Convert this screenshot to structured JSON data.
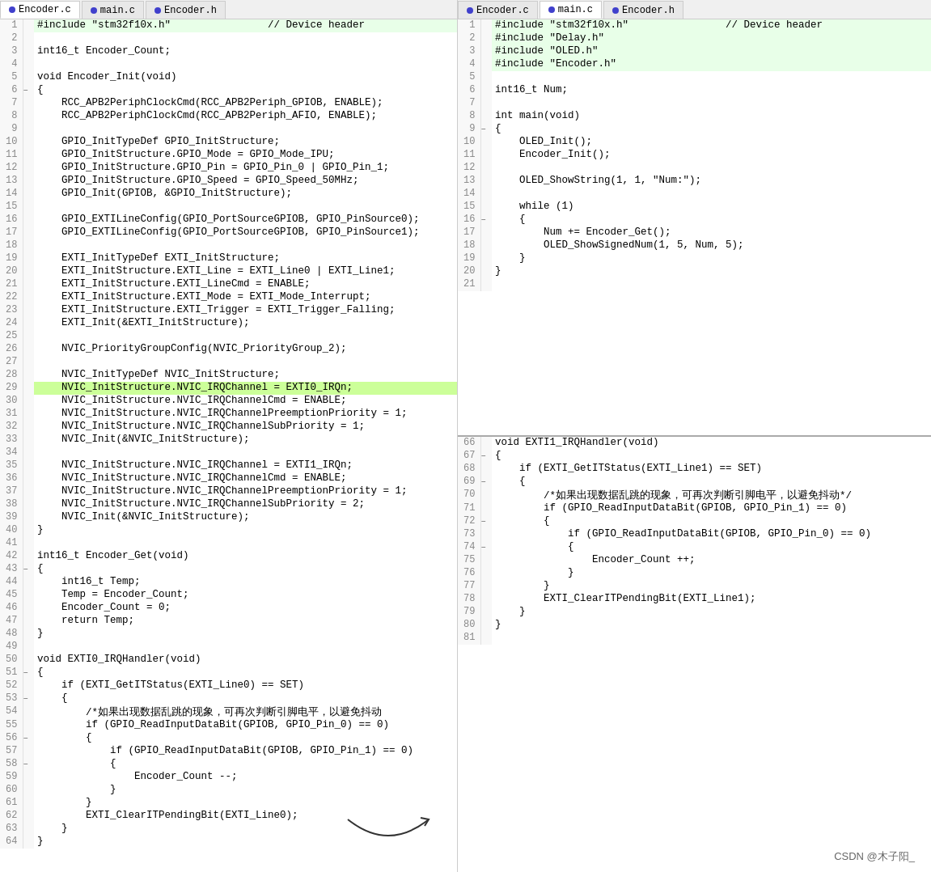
{
  "left_pane": {
    "tabs": [
      {
        "label": "Encoder.c",
        "active": true,
        "type": "encoder-c"
      },
      {
        "label": "main.c",
        "active": false,
        "type": "main-c"
      },
      {
        "label": "Encoder.h",
        "active": false,
        "type": "encoder-h"
      }
    ],
    "lines": [
      {
        "num": 1,
        "content": "#include \"stm32f10x.h\"                // Device header",
        "style": "include-green",
        "gutter": ""
      },
      {
        "num": 2,
        "content": "",
        "style": "",
        "gutter": ""
      },
      {
        "num": 3,
        "content": "int16_t Encoder_Count;",
        "style": "",
        "gutter": ""
      },
      {
        "num": 4,
        "content": "",
        "style": "",
        "gutter": ""
      },
      {
        "num": 5,
        "content": "void Encoder_Init(void)",
        "style": "",
        "gutter": ""
      },
      {
        "num": 6,
        "content": "{",
        "style": "",
        "gutter": "□"
      },
      {
        "num": 7,
        "content": "    RCC_APB2PeriphClockCmd(RCC_APB2Periph_GPIOB, ENABLE);",
        "style": "",
        "gutter": ""
      },
      {
        "num": 8,
        "content": "    RCC_APB2PeriphClockCmd(RCC_APB2Periph_AFIO, ENABLE);",
        "style": "",
        "gutter": ""
      },
      {
        "num": 9,
        "content": "",
        "style": "",
        "gutter": ""
      },
      {
        "num": 10,
        "content": "    GPIO_InitTypeDef GPIO_InitStructure;",
        "style": "",
        "gutter": ""
      },
      {
        "num": 11,
        "content": "    GPIO_InitStructure.GPIO_Mode = GPIO_Mode_IPU;",
        "style": "",
        "gutter": ""
      },
      {
        "num": 12,
        "content": "    GPIO_InitStructure.GPIO_Pin = GPIO_Pin_0 | GPIO_Pin_1;",
        "style": "",
        "gutter": ""
      },
      {
        "num": 13,
        "content": "    GPIO_InitStructure.GPIO_Speed = GPIO_Speed_50MHz;",
        "style": "",
        "gutter": ""
      },
      {
        "num": 14,
        "content": "    GPIO_Init(GPIOB, &GPIO_InitStructure);",
        "style": "",
        "gutter": ""
      },
      {
        "num": 15,
        "content": "",
        "style": "",
        "gutter": ""
      },
      {
        "num": 16,
        "content": "    GPIO_EXTILineConfig(GPIO_PortSourceGPIOB, GPIO_PinSource0);",
        "style": "",
        "gutter": ""
      },
      {
        "num": 17,
        "content": "    GPIO_EXTILineConfig(GPIO_PortSourceGPIOB, GPIO_PinSource1);",
        "style": "",
        "gutter": ""
      },
      {
        "num": 18,
        "content": "",
        "style": "",
        "gutter": ""
      },
      {
        "num": 19,
        "content": "    EXTI_InitTypeDef EXTI_InitStructure;",
        "style": "",
        "gutter": ""
      },
      {
        "num": 20,
        "content": "    EXTI_InitStructure.EXTI_Line = EXTI_Line0 | EXTI_Line1;",
        "style": "",
        "gutter": ""
      },
      {
        "num": 21,
        "content": "    EXTI_InitStructure.EXTI_LineCmd = ENABLE;",
        "style": "",
        "gutter": ""
      },
      {
        "num": 22,
        "content": "    EXTI_InitStructure.EXTI_Mode = EXTI_Mode_Interrupt;",
        "style": "",
        "gutter": ""
      },
      {
        "num": 23,
        "content": "    EXTI_InitStructure.EXTI_Trigger = EXTI_Trigger_Falling;",
        "style": "",
        "gutter": ""
      },
      {
        "num": 24,
        "content": "    EXTI_Init(&EXTI_InitStructure);",
        "style": "",
        "gutter": ""
      },
      {
        "num": 25,
        "content": "",
        "style": "",
        "gutter": ""
      },
      {
        "num": 26,
        "content": "    NVIC_PriorityGroupConfig(NVIC_PriorityGroup_2);",
        "style": "",
        "gutter": ""
      },
      {
        "num": 27,
        "content": "",
        "style": "",
        "gutter": ""
      },
      {
        "num": 28,
        "content": "    NVIC_InitTypeDef NVIC_InitStructure;",
        "style": "",
        "gutter": ""
      },
      {
        "num": 29,
        "content": "    NVIC_InitStructure.NVIC_IRQChannel = EXTI0_IRQn;",
        "style": "highlighted",
        "gutter": ""
      },
      {
        "num": 30,
        "content": "    NVIC_InitStructure.NVIC_IRQChannelCmd = ENABLE;",
        "style": "",
        "gutter": ""
      },
      {
        "num": 31,
        "content": "    NVIC_InitStructure.NVIC_IRQChannelPreemptionPriority = 1;",
        "style": "",
        "gutter": ""
      },
      {
        "num": 32,
        "content": "    NVIC_InitStructure.NVIC_IRQChannelSubPriority = 1;",
        "style": "",
        "gutter": ""
      },
      {
        "num": 33,
        "content": "    NVIC_Init(&NVIC_InitStructure);",
        "style": "",
        "gutter": ""
      },
      {
        "num": 34,
        "content": "",
        "style": "",
        "gutter": ""
      },
      {
        "num": 35,
        "content": "    NVIC_InitStructure.NVIC_IRQChannel = EXTI1_IRQn;",
        "style": "",
        "gutter": ""
      },
      {
        "num": 36,
        "content": "    NVIC_InitStructure.NVIC_IRQChannelCmd = ENABLE;",
        "style": "",
        "gutter": ""
      },
      {
        "num": 37,
        "content": "    NVIC_InitStructure.NVIC_IRQChannelPreemptionPriority = 1;",
        "style": "",
        "gutter": ""
      },
      {
        "num": 38,
        "content": "    NVIC_InitStructure.NVIC_IRQChannelSubPriority = 2;",
        "style": "",
        "gutter": ""
      },
      {
        "num": 39,
        "content": "    NVIC_Init(&NVIC_InitStructure);",
        "style": "",
        "gutter": ""
      },
      {
        "num": 40,
        "content": "}",
        "style": "",
        "gutter": ""
      },
      {
        "num": 41,
        "content": "",
        "style": "",
        "gutter": ""
      },
      {
        "num": 42,
        "content": "int16_t Encoder_Get(void)",
        "style": "",
        "gutter": ""
      },
      {
        "num": 43,
        "content": "{",
        "style": "",
        "gutter": "□"
      },
      {
        "num": 44,
        "content": "    int16_t Temp;",
        "style": "",
        "gutter": ""
      },
      {
        "num": 45,
        "content": "    Temp = Encoder_Count;",
        "style": "",
        "gutter": ""
      },
      {
        "num": 46,
        "content": "    Encoder_Count = 0;",
        "style": "",
        "gutter": ""
      },
      {
        "num": 47,
        "content": "    return Temp;",
        "style": "",
        "gutter": ""
      },
      {
        "num": 48,
        "content": "}",
        "style": "",
        "gutter": ""
      },
      {
        "num": 49,
        "content": "",
        "style": "",
        "gutter": ""
      },
      {
        "num": 50,
        "content": "void EXTI0_IRQHandler(void)",
        "style": "",
        "gutter": ""
      },
      {
        "num": 51,
        "content": "{",
        "style": "",
        "gutter": "□"
      },
      {
        "num": 52,
        "content": "    if (EXTI_GetITStatus(EXTI_Line0) == SET)",
        "style": "",
        "gutter": ""
      },
      {
        "num": 53,
        "content": "    {",
        "style": "",
        "gutter": "□"
      },
      {
        "num": 54,
        "content": "        /*如果出现数据乱跳的现象，可再次判断引脚电平，以避免抖动",
        "style": "",
        "gutter": ""
      },
      {
        "num": 55,
        "content": "        if (GPIO_ReadInputDataBit(GPIOB, GPIO_Pin_0) == 0)",
        "style": "",
        "gutter": ""
      },
      {
        "num": 56,
        "content": "        {",
        "style": "",
        "gutter": "□"
      },
      {
        "num": 57,
        "content": "            if (GPIO_ReadInputDataBit(GPIOB, GPIO_Pin_1) == 0)",
        "style": "",
        "gutter": ""
      },
      {
        "num": 58,
        "content": "            {",
        "style": "",
        "gutter": "□"
      },
      {
        "num": 59,
        "content": "                Encoder_Count --;",
        "style": "",
        "gutter": ""
      },
      {
        "num": 60,
        "content": "            }",
        "style": "",
        "gutter": ""
      },
      {
        "num": 61,
        "content": "        }",
        "style": "",
        "gutter": ""
      },
      {
        "num": 62,
        "content": "        EXTI_ClearITPendingBit(EXTI_Line0);",
        "style": "",
        "gutter": ""
      },
      {
        "num": 63,
        "content": "    }",
        "style": "",
        "gutter": ""
      },
      {
        "num": 64,
        "content": "}",
        "style": "",
        "gutter": ""
      }
    ]
  },
  "right_pane_top": {
    "tabs": [
      {
        "label": "Encoder.c",
        "active": false,
        "type": "encoder-c"
      },
      {
        "label": "main.c",
        "active": true,
        "type": "main-c"
      },
      {
        "label": "Encoder.h",
        "active": false,
        "type": "encoder-h"
      }
    ],
    "lines": [
      {
        "num": 1,
        "content": "#include \"stm32f10x.h\"                // Device header",
        "style": "include-green"
      },
      {
        "num": 2,
        "content": "#include \"Delay.h\"",
        "style": "include-green"
      },
      {
        "num": 3,
        "content": "#include \"OLED.h\"",
        "style": "include-green"
      },
      {
        "num": 4,
        "content": "#include \"Encoder.h\"",
        "style": "include-green"
      },
      {
        "num": 5,
        "content": "",
        "style": ""
      },
      {
        "num": 6,
        "content": "int16_t Num;",
        "style": ""
      },
      {
        "num": 7,
        "content": "",
        "style": ""
      },
      {
        "num": 8,
        "content": "int main(void)",
        "style": ""
      },
      {
        "num": 9,
        "content": "{",
        "style": "",
        "gutter": "□"
      },
      {
        "num": 10,
        "content": "    OLED_Init();",
        "style": ""
      },
      {
        "num": 11,
        "content": "    Encoder_Init();",
        "style": ""
      },
      {
        "num": 12,
        "content": "",
        "style": ""
      },
      {
        "num": 13,
        "content": "    OLED_ShowString(1, 1, \"Num:\");",
        "style": ""
      },
      {
        "num": 14,
        "content": "",
        "style": ""
      },
      {
        "num": 15,
        "content": "    while (1)",
        "style": ""
      },
      {
        "num": 16,
        "content": "    {",
        "style": "",
        "gutter": "□"
      },
      {
        "num": 17,
        "content": "        Num += Encoder_Get();",
        "style": ""
      },
      {
        "num": 18,
        "content": "        OLED_ShowSignedNum(1, 5, Num, 5);",
        "style": ""
      },
      {
        "num": 19,
        "content": "    }",
        "style": ""
      },
      {
        "num": 20,
        "content": "}",
        "style": ""
      },
      {
        "num": 21,
        "content": "",
        "style": ""
      }
    ]
  },
  "right_pane_bottom": {
    "lines": [
      {
        "num": 66,
        "content": "void EXTI1_IRQHandler(void)",
        "style": ""
      },
      {
        "num": 67,
        "content": "{",
        "style": "",
        "gutter": "□"
      },
      {
        "num": 68,
        "content": "    if (EXTI_GetITStatus(EXTI_Line1) == SET)",
        "style": ""
      },
      {
        "num": 69,
        "content": "    {",
        "style": "",
        "gutter": "□"
      },
      {
        "num": 70,
        "content": "        /*如果出现数据乱跳的现象，可再次判断引脚电平，以避免抖动*/",
        "style": ""
      },
      {
        "num": 71,
        "content": "        if (GPIO_ReadInputDataBit(GPIOB, GPIO_Pin_1) == 0)",
        "style": ""
      },
      {
        "num": 72,
        "content": "        {",
        "style": "",
        "gutter": "□"
      },
      {
        "num": 73,
        "content": "            if (GPIO_ReadInputDataBit(GPIOB, GPIO_Pin_0) == 0)",
        "style": ""
      },
      {
        "num": 74,
        "content": "            {",
        "style": "",
        "gutter": "□"
      },
      {
        "num": 75,
        "content": "                Encoder_Count ++;",
        "style": ""
      },
      {
        "num": 76,
        "content": "            }",
        "style": ""
      },
      {
        "num": 77,
        "content": "        }",
        "style": ""
      },
      {
        "num": 78,
        "content": "        EXTI_ClearITPendingBit(EXTI_Line1);",
        "style": ""
      },
      {
        "num": 79,
        "content": "    }",
        "style": ""
      },
      {
        "num": 80,
        "content": "}",
        "style": ""
      },
      {
        "num": 81,
        "content": "",
        "style": ""
      }
    ]
  },
  "watermark": "CSDN @木子阳_"
}
